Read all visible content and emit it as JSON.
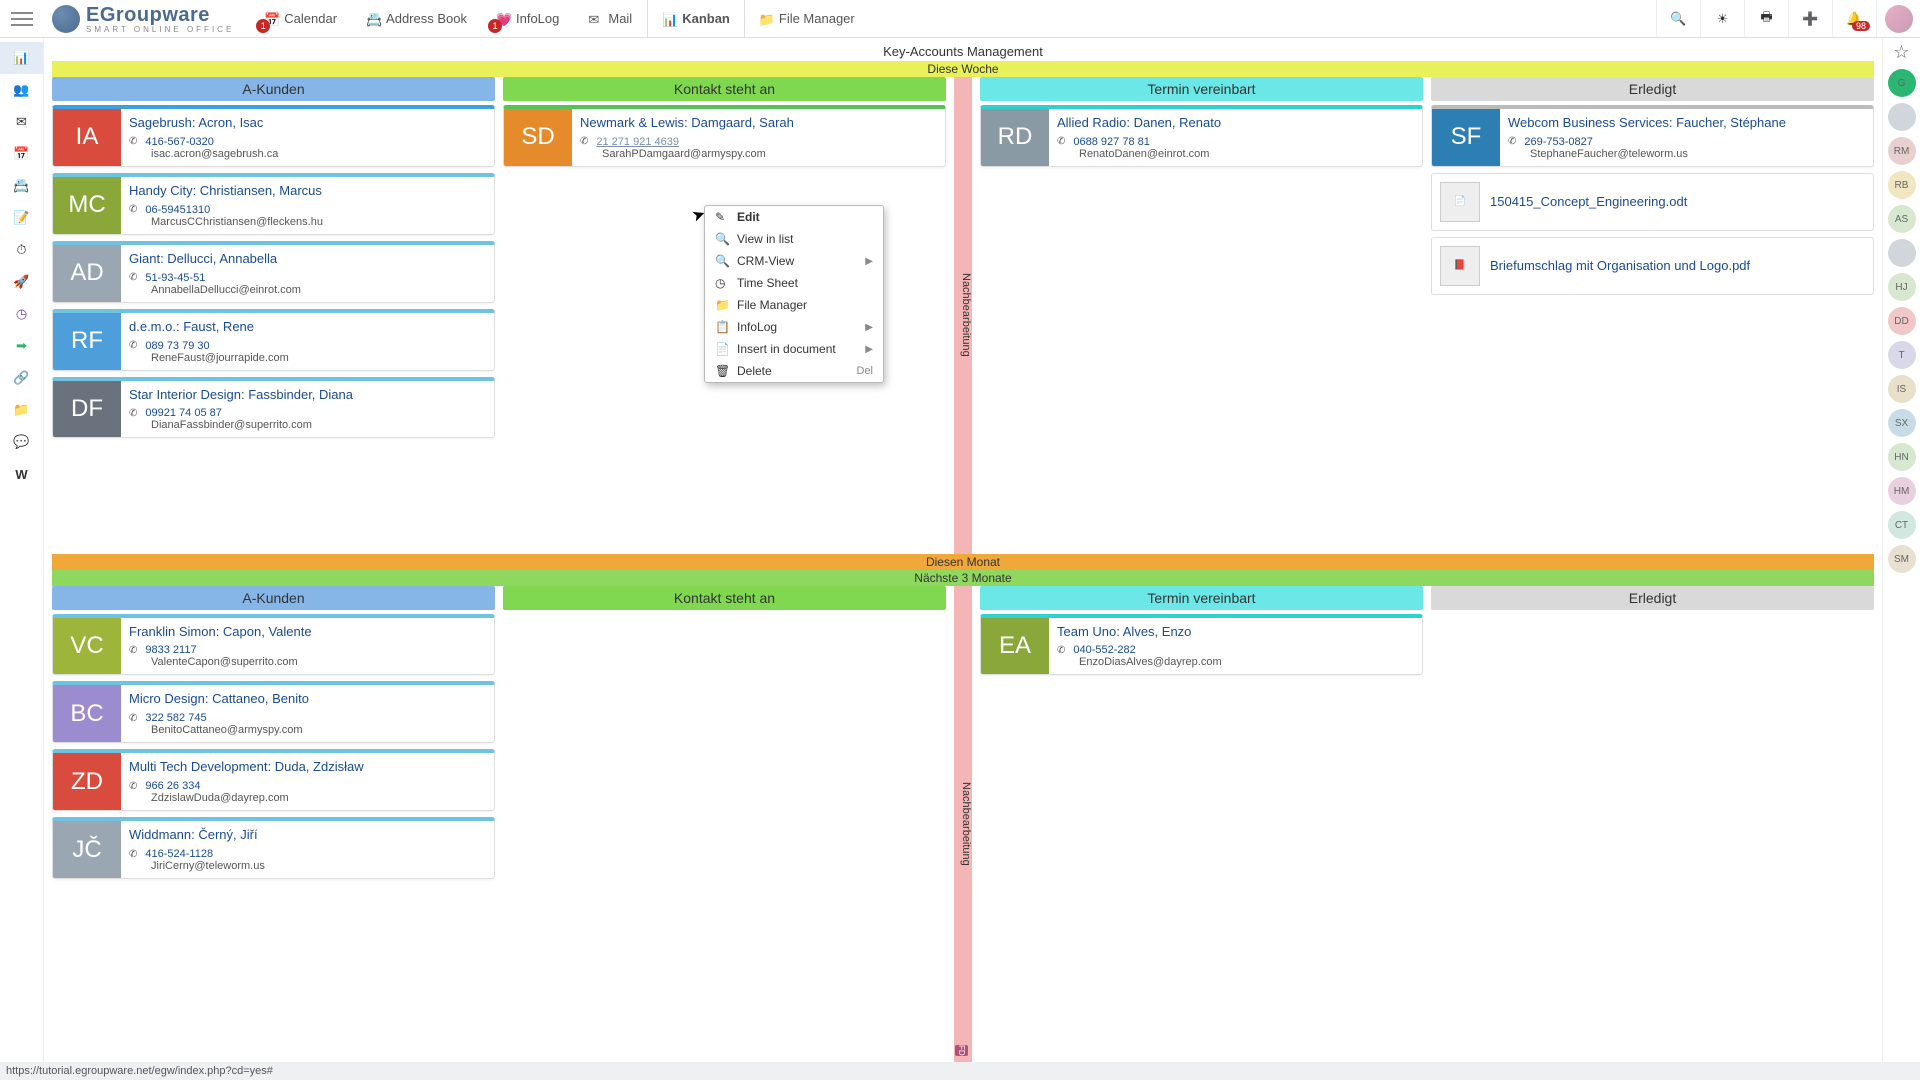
{
  "app": {
    "name": "EGroupware",
    "tagline": "SMART ONLINE OFFICE"
  },
  "topnav": [
    {
      "label": "Calendar",
      "icon": "📅",
      "badge": "1"
    },
    {
      "label": "Address Book",
      "icon": "📇"
    },
    {
      "label": "InfoLog",
      "icon": "💗",
      "badge": "1"
    },
    {
      "label": "Mail",
      "icon": "✉"
    },
    {
      "label": "Kanban",
      "icon": "📊",
      "active": true
    },
    {
      "label": "File Manager",
      "icon": "📁"
    }
  ],
  "toptools": {
    "notif_count": "98"
  },
  "board": {
    "title": "Key-Accounts Management",
    "swimlanes": [
      {
        "header": "Diese Woche",
        "cls": "hdr-yellow"
      },
      {
        "header": "Diesen Monat",
        "cls": "hdr-orange"
      },
      {
        "header": "Nächste 3 Monate",
        "cls": "hdr-green"
      }
    ],
    "columns": [
      "A-Kunden",
      "Kontakt steht an",
      "Termin vereinbart",
      "Erledigt"
    ],
    "vdivider": "Nachbearbeitung",
    "vdivider_badge": "FD"
  },
  "lane0": {
    "col0": [
      {
        "ini": "IA",
        "bg": "#d94c3d",
        "top": "#3aa0e0",
        "title": "Sagebrush: Acron, Isac",
        "phone": "416-567-0320",
        "email": "isac.acron@sagebrush.ca"
      },
      {
        "ini": "MC",
        "bg": "#8aa83a",
        "top": "#6ec3e0",
        "title": "Handy City: Christiansen, Marcus",
        "phone": "06-59451310",
        "email": "MarcusCChristiansen@fleckens.hu"
      },
      {
        "ini": "AD",
        "bg": "#9aa7b3",
        "top": "#6ec3e0",
        "title": "Giant: Dellucci, Annabella",
        "phone": "51-93-45-51",
        "email": "AnnabellaDellucci@einrot.com"
      },
      {
        "ini": "RF",
        "bg": "#4e9fd9",
        "top": "#6ec3e0",
        "title": "d.e.m.o.: Faust, Rene",
        "phone": "089 73 79 30",
        "email": "ReneFaust@jourrapide.com"
      },
      {
        "ini": "DF",
        "bg": "#6a737d",
        "top": "#6ec3e0",
        "title": "Star Interior Design: Fassbinder, Diana",
        "phone": "09921 74 05 87",
        "email": "DianaFassbinder@superrito.com"
      }
    ],
    "col1": [
      {
        "ini": "SD",
        "bg": "#e58b2b",
        "top": "#57c257",
        "title": "Newmark & Lewis: Damgaard, Sarah",
        "phone": "21 271 921 4639",
        "phone_link": true,
        "email": "SarahPDamgaard@armyspy.com"
      }
    ],
    "col2": [
      {
        "ini": "RD",
        "bg": "#8a9aa5",
        "top": "#2fd0d0",
        "title": "Allied Radio: Danen, Renato",
        "phone": "0688 927 78 81",
        "email": "RenatoDanen@einrot.com"
      }
    ],
    "col3": [
      {
        "ini": "SF",
        "bg": "#2d7fb3",
        "top": "#bbb",
        "title": "Webcom Business Services: Faucher, Stéphane",
        "phone": "269-753-0827",
        "email": "StephaneFaucher@teleworm.us"
      }
    ],
    "col3_files": [
      {
        "icon": "doc",
        "name": "150415_Concept_Engineering.odt"
      },
      {
        "icon": "pdf",
        "name": "Briefumschlag mit Organisation und Logo.pdf"
      }
    ]
  },
  "lane1": {
    "col0": [
      {
        "ini": "VC",
        "bg": "#9db53a",
        "top": "#6ec3e0",
        "title": "Franklin Simon: Capon, Valente",
        "phone": "9833 2117",
        "email": "ValenteCapon@superrito.com"
      },
      {
        "ini": "BC",
        "bg": "#9a8ccf",
        "top": "#6ec3e0",
        "title": "Micro Design: Cattaneo, Benito",
        "phone": "322 582 745",
        "email": "BenitoCattaneo@armyspy.com"
      },
      {
        "ini": "ZD",
        "bg": "#d94c3d",
        "top": "#6ec3e0",
        "title": "Multi Tech Development:  Duda, Zdzisław",
        "phone": "966 26 334",
        "email": "ZdzislawDuda@dayrep.com"
      },
      {
        "ini": "JČ",
        "bg": "#9aa7b3",
        "top": "#6ec3e0",
        "title": "Widdmann: Černý, Jiří",
        "phone": "416-524-1128",
        "email": "JiriCerny@teleworm.us"
      }
    ],
    "col2": [
      {
        "ini": "EA",
        "bg": "#8aa83a",
        "top": "#2fd0d0",
        "title": "Team Uno: Alves, Enzo",
        "phone": "040-552-282",
        "email": "EnzoDiasAlves@dayrep.com"
      }
    ]
  },
  "contextmenu": {
    "items": [
      {
        "label": "Edit",
        "icon": "✎",
        "bold": true
      },
      {
        "label": "View in list",
        "icon": "🔍"
      },
      {
        "label": "CRM-View",
        "icon": "🔍",
        "sub": true
      },
      {
        "label": "Time Sheet",
        "icon": "◷"
      },
      {
        "label": "File Manager",
        "icon": "📁"
      },
      {
        "label": "InfoLog",
        "icon": "📋",
        "sub": true
      },
      {
        "label": "Insert in document",
        "icon": "📄",
        "sub": true
      },
      {
        "label": "Delete",
        "icon": "🗑",
        "kbd": "Del"
      }
    ]
  },
  "rightbar": [
    {
      "txt": "G",
      "bg": "#2bb673"
    },
    {
      "txt": "",
      "bg": "#d0d6dc"
    },
    {
      "txt": "RM",
      "bg": "#e8d0d0"
    },
    {
      "txt": "RB",
      "bg": "#f0e6c0"
    },
    {
      "txt": "AS",
      "bg": "#d8e8d0"
    },
    {
      "txt": "",
      "bg": "#d0d6dc"
    },
    {
      "txt": "HJ",
      "bg": "#d8e8d0"
    },
    {
      "txt": "DD",
      "bg": "#f0c8c8"
    },
    {
      "txt": "T",
      "bg": "#d8d8e8"
    },
    {
      "txt": "IS",
      "bg": "#e8e0c8"
    },
    {
      "txt": "SX",
      "bg": "#c8dce8"
    },
    {
      "txt": "HN",
      "bg": "#d8e8d0"
    },
    {
      "txt": "HM",
      "bg": "#e8d0e0"
    },
    {
      "txt": "CT",
      "bg": "#d0e8e0"
    },
    {
      "txt": "SM",
      "bg": "#e8e0d0"
    }
  ],
  "statusbar": "https://tutorial.egroupware.net/egw/index.php?cd=yes#"
}
